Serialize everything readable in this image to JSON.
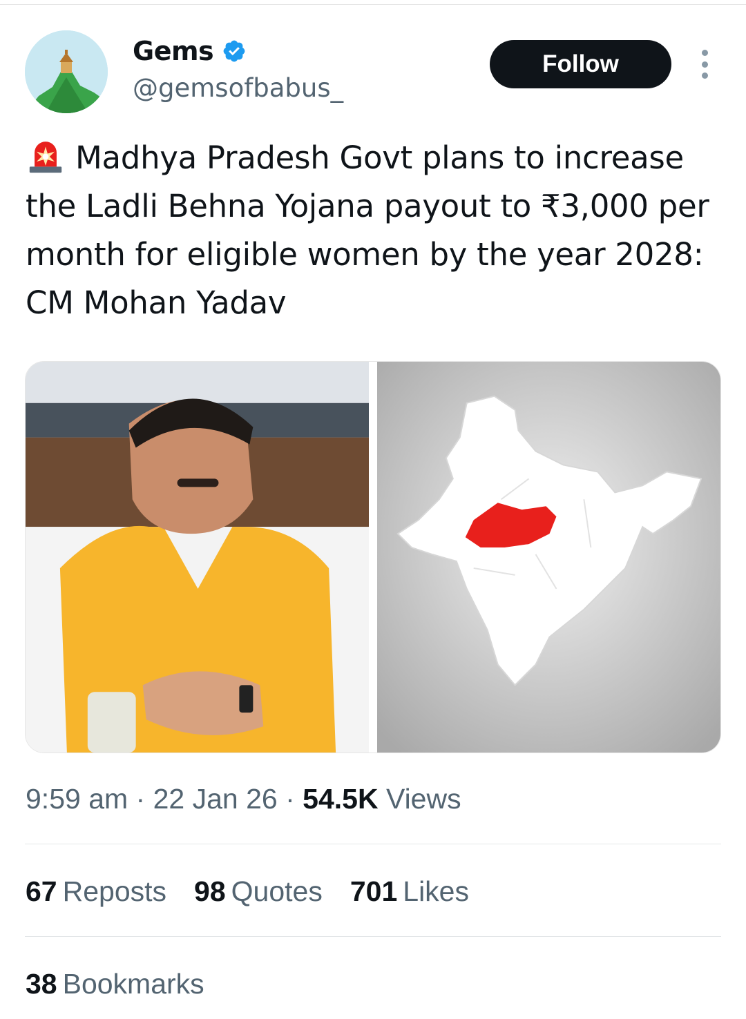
{
  "author": {
    "display_name": "Gems",
    "handle": "@gemsofbabus_",
    "verified_icon": "verified-badge-icon",
    "avatar_icon": "mountain-temple-avatar"
  },
  "header": {
    "follow_label": "Follow",
    "more_icon": "more-vertical-icon"
  },
  "tweet": {
    "emoji_icon": "police-siren-icon",
    "text": "Madhya Pradesh Govt plans to increase the Ladli Behna Yojana payout to ₹3,000 per month for eligible women by the year 2028: CM Mohan Yadav"
  },
  "media": {
    "left_image": "photo-man-in-saffron-jacket",
    "right_image": "map-of-india-madhya-pradesh-highlighted"
  },
  "meta": {
    "time": "9:59 am",
    "sep1": " · ",
    "date": "22 Jan 26",
    "sep2": " · ",
    "views_count": "54.5K",
    "views_label": "Views"
  },
  "stats": {
    "reposts_count": "67",
    "reposts_label": "Reposts",
    "quotes_count": "98",
    "quotes_label": "Quotes",
    "likes_count": "701",
    "likes_label": "Likes",
    "bookmarks_count": "38",
    "bookmarks_label": "Bookmarks"
  },
  "colors": {
    "text_primary": "#0f1419",
    "text_secondary": "#536471",
    "verified_blue": "#1d9bf0",
    "follow_bg": "#0f1419",
    "highlight_red": "#e8201c"
  }
}
